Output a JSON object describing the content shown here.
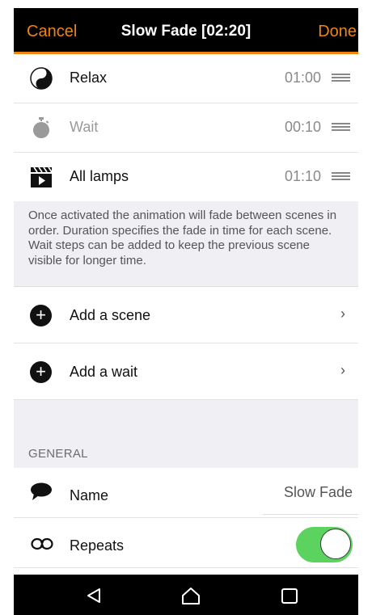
{
  "header": {
    "cancel_label": "Cancel",
    "title": "Slow Fade [02:20]",
    "done_label": "Done"
  },
  "steps": [
    {
      "label": "Relax",
      "duration": "01:00",
      "icon": "yin-yang-icon",
      "dimmed": false
    },
    {
      "label": "Wait",
      "duration": "00:10",
      "icon": "stopwatch-icon",
      "dimmed": true
    },
    {
      "label": "All lamps",
      "duration": "01:10",
      "icon": "clapperboard-icon",
      "dimmed": false
    }
  ],
  "info_text": "Once activated the animation will fade between scenes in order. Duration specifies the fade in time for each scene. Wait steps can be added to keep the previous scene visible for longer time.",
  "actions": {
    "add_scene": "Add a scene",
    "add_wait": "Add a wait",
    "chevron": "›"
  },
  "general": {
    "header": "GENERAL",
    "name_label": "Name",
    "name_value": "Slow Fade",
    "repeats_label": "Repeats",
    "repeats_on": true
  },
  "colors": {
    "accent": "#f0840f",
    "toggle_on": "#5cd35f",
    "background_gray": "#efeff4"
  }
}
